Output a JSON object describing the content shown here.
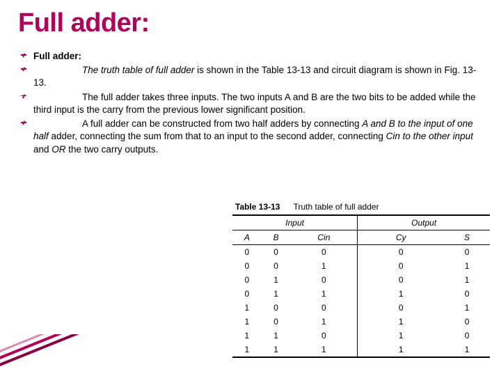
{
  "title": "Full adder:",
  "bullets": {
    "b1_strong": "Full adder:",
    "b2_pre_italic": "The truth table of full adder",
    "b2_rest": " is shown in the Table 13-13 and circuit diagram is shown in Fig. 13-13.",
    "b3": "The full adder takes three inputs. The two inputs A and B are the two bits to be added while the third input is the carry from the previous lower significant position.",
    "b4_p1": "A full adder can be constructed from two half adders by connecting ",
    "b4_i1": "A and B to the input of one half ",
    "b4_p2": "adder, connecting the sum from that to an input to the second adder, connecting ",
    "b4_i2": "Cin to the other input ",
    "b4_p3": " and ",
    "b4_i3": "OR ",
    "b4_p4": "the two carry outputs."
  },
  "table": {
    "caption_label": "Table 13-13",
    "caption_text": "Truth table of full adder",
    "group_input": "Input",
    "group_output": "Output",
    "col_A": "A",
    "col_B": "B",
    "col_Cin": "Cin",
    "col_Cy": "Cy",
    "col_S": "S",
    "rows": [
      [
        "0",
        "0",
        "0",
        "0",
        "0"
      ],
      [
        "0",
        "0",
        "1",
        "0",
        "1"
      ],
      [
        "0",
        "1",
        "0",
        "0",
        "1"
      ],
      [
        "0",
        "1",
        "1",
        "1",
        "0"
      ],
      [
        "1",
        "0",
        "0",
        "0",
        "1"
      ],
      [
        "1",
        "0",
        "1",
        "1",
        "0"
      ],
      [
        "1",
        "1",
        "0",
        "1",
        "0"
      ],
      [
        "1",
        "1",
        "1",
        "1",
        "1"
      ]
    ]
  }
}
